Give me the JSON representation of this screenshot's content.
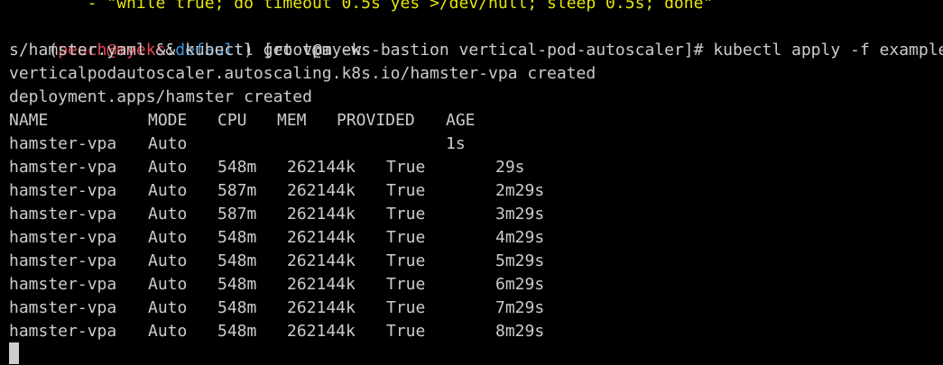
{
  "scrolled_line": "        - \"while true; do timeout 0.5s yes >/dev/null; sleep 0.5s; done\"",
  "prompt": {
    "open": "(",
    "user": "peach@myeks",
    "colon": ":",
    "context": "default",
    "close": ")",
    "shell": " [root@myeks-bastion vertical-pod-autoscaler]# ",
    "command_part1": "kubectl apply -f example",
    "command_part2": "s/hamster.yaml && kubectl get vpa -w"
  },
  "output": [
    "verticalpodautoscaler.autoscaling.k8s.io/hamster-vpa created",
    "deployment.apps/hamster created"
  ],
  "table": {
    "headers": [
      "NAME",
      "MODE",
      "CPU",
      "MEM",
      "PROVIDED",
      "AGE"
    ],
    "rows": [
      [
        "hamster-vpa",
        "Auto",
        "",
        "",
        "",
        "1s"
      ],
      [
        "hamster-vpa",
        "Auto",
        "548m",
        "262144k",
        "True",
        "29s"
      ],
      [
        "hamster-vpa",
        "Auto",
        "587m",
        "262144k",
        "True",
        "2m29s"
      ],
      [
        "hamster-vpa",
        "Auto",
        "587m",
        "262144k",
        "True",
        "3m29s"
      ],
      [
        "hamster-vpa",
        "Auto",
        "548m",
        "262144k",
        "True",
        "4m29s"
      ],
      [
        "hamster-vpa",
        "Auto",
        "548m",
        "262144k",
        "True",
        "5m29s"
      ],
      [
        "hamster-vpa",
        "Auto",
        "548m",
        "262144k",
        "True",
        "6m29s"
      ],
      [
        "hamster-vpa",
        "Auto",
        "548m",
        "262144k",
        "True",
        "7m29s"
      ],
      [
        "hamster-vpa",
        "Auto",
        "548m",
        "262144k",
        "True",
        "8m29s"
      ]
    ]
  },
  "colors": {
    "background": "#000000",
    "text": "#cccccc",
    "scrolled_line": "#e5e510",
    "prompt_user": "#e74856",
    "prompt_context": "#3a96dd",
    "cursor": "#cccccc"
  }
}
